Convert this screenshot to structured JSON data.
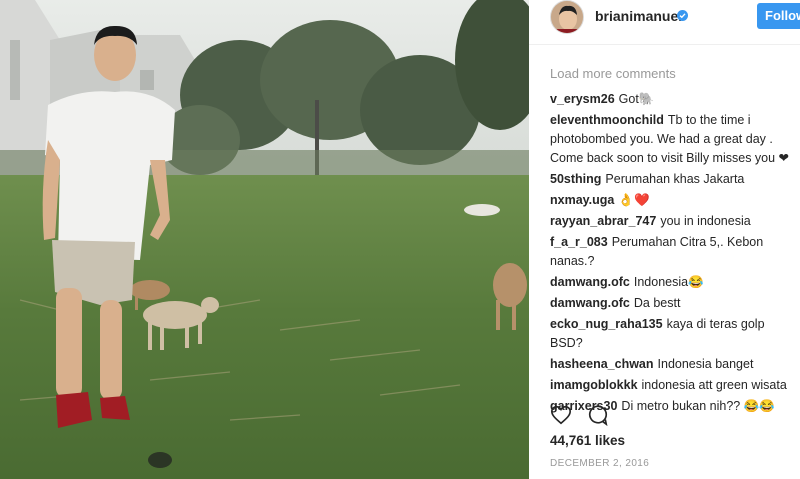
{
  "post": {
    "username": "brianimanuel",
    "follow_label": "Follow",
    "load_more": "Load more comments",
    "comments": [
      {
        "user": "v_erysm26",
        "text": "Got🐘"
      },
      {
        "user": "eleventhmoonchild",
        "text": "Tb to the time i photobombed you. We had a great day . Come back soon to visit Billy misses you ❤"
      },
      {
        "user": "50sthing",
        "text": "Perumahan khas Jakarta"
      },
      {
        "user": "nxmay.uga",
        "text": "👌❤️"
      },
      {
        "user": "rayyan_abrar_747",
        "text": "you in indonesia"
      },
      {
        "user": "f_a_r_083",
        "text": "Perumahan Citra 5,. Kebon nanas.?"
      },
      {
        "user": "damwang.ofc",
        "text": "Indonesia😂"
      },
      {
        "user": "damwang.ofc",
        "text": "Da bestt"
      },
      {
        "user": "ecko_nug_raha135",
        "text": "kaya di teras golp BSD?"
      },
      {
        "user": "hasheena_chwan",
        "text": "Indonesia banget"
      },
      {
        "user": "imamgoblokkk",
        "text": "indonesia att green wisata"
      },
      {
        "user": "garrixers30",
        "text": "Di metro bukan nih?? 😂😂"
      }
    ],
    "likes": "44,761 likes",
    "date": "DECEMBER 2, 2016",
    "icons": {
      "like": "heart-icon",
      "comment": "comment-bubble-icon",
      "verified": "verified-badge-icon"
    },
    "colors": {
      "accent": "#3897f0",
      "text": "#262626",
      "muted": "#999999"
    }
  }
}
